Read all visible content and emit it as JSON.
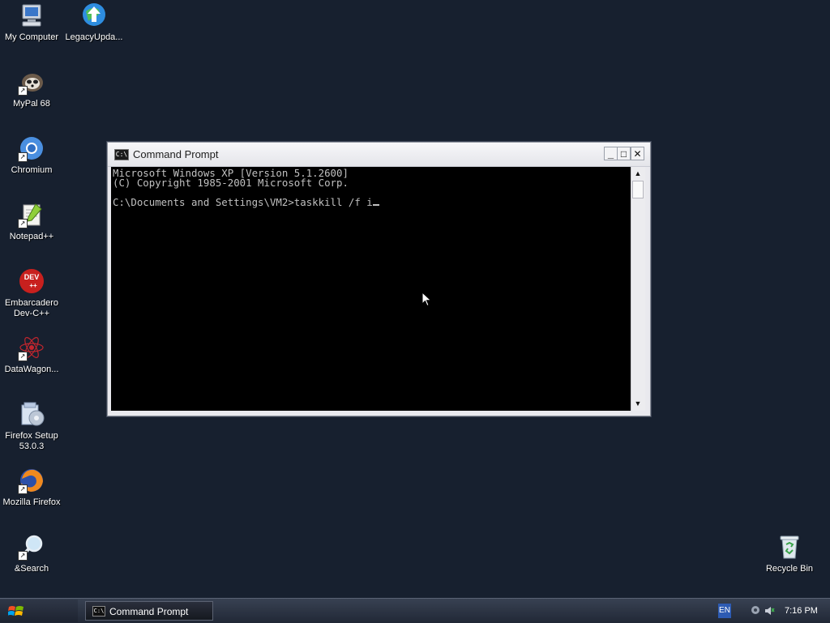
{
  "desktop": {
    "icons": [
      {
        "label": "My Computer",
        "icon": "my-computer-icon"
      },
      {
        "label": "LegacyUpda...",
        "icon": "legacy-update-icon"
      },
      {
        "label": "MyPal 68",
        "icon": "mypal-icon"
      },
      {
        "label": "Chromium",
        "icon": "chromium-icon"
      },
      {
        "label": "Notepad++",
        "icon": "notepad-plus-plus-icon"
      },
      {
        "label": "Embarcadero\nDev-C++",
        "icon": "devcpp-icon"
      },
      {
        "label": "DataWagon...",
        "icon": "datawagon-icon"
      },
      {
        "label": "Firefox Setup\n53.0.3",
        "icon": "firefox-setup-icon"
      },
      {
        "label": "Mozilla Firefox",
        "icon": "firefox-icon"
      },
      {
        "label": "&Search",
        "icon": "search-icon"
      },
      {
        "label": "Recycle Bin",
        "icon": "recycle-bin-icon"
      }
    ],
    "devcpp_badge": "DEV\n++"
  },
  "cmd_window": {
    "title": "Command Prompt",
    "title_icon_text": "C:\\",
    "lines": [
      "Microsoft Windows XP [Version 5.1.2600]",
      "(C) Copyright 1985-2001 Microsoft Corp.",
      "",
      "C:\\Documents and Settings\\VM2>taskkill /f i"
    ],
    "buttons": {
      "minimize": "_",
      "maximize": "□",
      "close": "✕"
    }
  },
  "taskbar": {
    "task_label": "Command Prompt",
    "language": "EN",
    "clock": "7:16 PM"
  },
  "colors": {
    "desktop_bg": "#17202f",
    "console_bg": "#000000",
    "console_fg": "#c0c0c0"
  }
}
